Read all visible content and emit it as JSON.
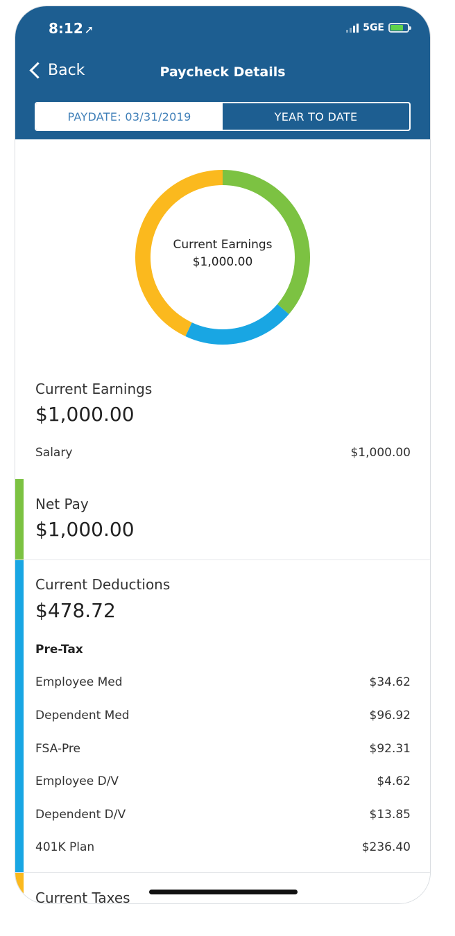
{
  "status": {
    "time": "8:12",
    "network": "5GE"
  },
  "nav": {
    "back_label": "Back",
    "title": "Paycheck Details"
  },
  "tabs": [
    {
      "label": "PAYDATE: 03/31/2019",
      "active": true
    },
    {
      "label": "YEAR TO DATE",
      "active": false
    }
  ],
  "donut": {
    "center_label": "Current Earnings",
    "center_value": "$1,000.00",
    "segments": [
      {
        "name": "Net Pay",
        "color": "#7cc242",
        "share": 0.3628
      },
      {
        "name": "Current Deductions",
        "color": "#19a6e3",
        "share": 0.2071
      },
      {
        "name": "Current Taxes",
        "color": "#fbb91e",
        "share": 0.4301
      }
    ]
  },
  "earnings": {
    "label": "Current Earnings",
    "amount": "$1,000.00",
    "items": [
      {
        "name": "Salary",
        "value": "$1,000.00"
      }
    ]
  },
  "net_pay": {
    "label": "Net Pay",
    "amount": "$1,000.00",
    "color": "#7cc242"
  },
  "deductions": {
    "label": "Current Deductions",
    "amount": "$478.72",
    "color": "#19a6e3",
    "subhead": "Pre-Tax",
    "items": [
      {
        "name": "Employee Med",
        "value": "$34.62"
      },
      {
        "name": "Dependent Med",
        "value": "$96.92"
      },
      {
        "name": "FSA-Pre",
        "value": "$92.31"
      },
      {
        "name": "Employee D/V",
        "value": "$4.62"
      },
      {
        "name": "Dependent D/V",
        "value": "$13.85"
      },
      {
        "name": "401K Plan",
        "value": "$236.40"
      }
    ]
  },
  "taxes": {
    "label": "Current Taxes",
    "color": "#fbb91e"
  }
}
